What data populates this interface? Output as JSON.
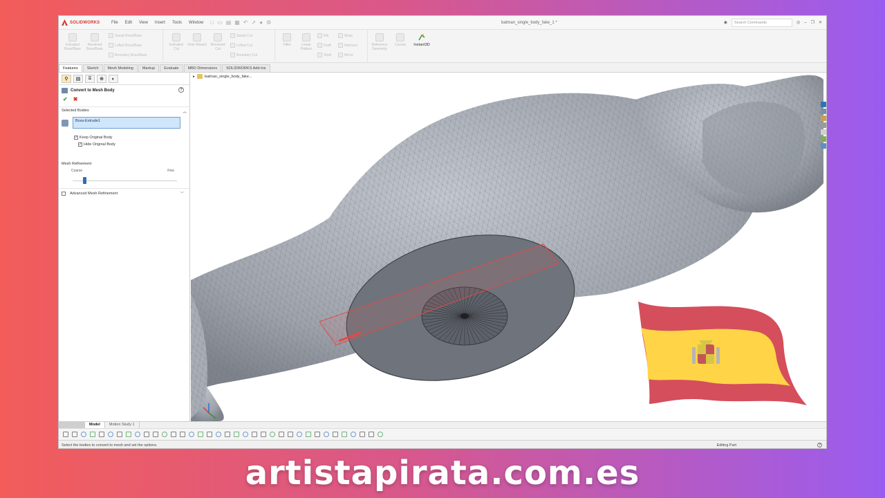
{
  "app": {
    "brand": "SOLIDWORKS",
    "menus": [
      "File",
      "Edit",
      "View",
      "Insert",
      "Tools",
      "Window"
    ],
    "document_title": "batman_single_body_fake_1 *",
    "search_placeholder": "Search Commands"
  },
  "ribbon": {
    "buttons": [
      {
        "label": "Extruded Boss/Base",
        "icon": "extrude-icon"
      },
      {
        "label": "Revolved Boss/Base",
        "icon": "revolve-icon"
      },
      {
        "label": "Extruded Cut",
        "icon": "cut-extrude-icon"
      },
      {
        "label": "Hole Wizard",
        "icon": "hole-icon"
      },
      {
        "label": "Revolved Cut",
        "icon": "revolve-cut-icon"
      },
      {
        "label": "Fillet",
        "icon": "fillet-icon"
      },
      {
        "label": "Linear Pattern",
        "icon": "pattern-icon"
      },
      {
        "label": "Reference Geometry",
        "icon": "plane-icon"
      },
      {
        "label": "Curves",
        "icon": "curve-icon"
      }
    ],
    "small": [
      "Swept Boss/Base",
      "Lofted Boss/Base",
      "Boundary Boss/Base",
      "Swept Cut",
      "Lofted Cut",
      "Boundary Cut",
      "Rib",
      "Draft",
      "Shell",
      "Wrap",
      "Intersect",
      "Mirror"
    ],
    "instant3d": "Instant3D"
  },
  "tabs": [
    "Features",
    "Sketch",
    "Mesh Modeling",
    "Markup",
    "Evaluate",
    "MBD Dimensions",
    "SOLIDWORKS Add-Ins"
  ],
  "panel": {
    "title": "Convert to Mesh Body",
    "ok": "✔",
    "cancel": "✖",
    "help": "?",
    "selected_bodies_label": "Selected Bodies",
    "selected_value": "Boss-Extrude1",
    "keep_original": "Keep Original Body",
    "hide_original": "Hide Original Body",
    "mesh_refinement_label": "Mesh Refinement",
    "coarse": "Coarse",
    "fine": "Fine",
    "slider_value": 0.1,
    "advanced": "Advanced Mesh Refinement"
  },
  "viewport": {
    "tree_item": "batman_single_body_fake..."
  },
  "bottom_tabs": [
    "Model",
    "Motion Study 1"
  ],
  "status": {
    "hint": "Select the bodies to convert to mesh and set the options.",
    "mode": "Editing Part"
  },
  "website": "artistapirata.com.es",
  "colors": {
    "flag_red": "#c60b1e",
    "flag_yellow": "#ffc400",
    "model_gray": "#9ea3ac",
    "selection_blue": "#cfe6fb"
  }
}
